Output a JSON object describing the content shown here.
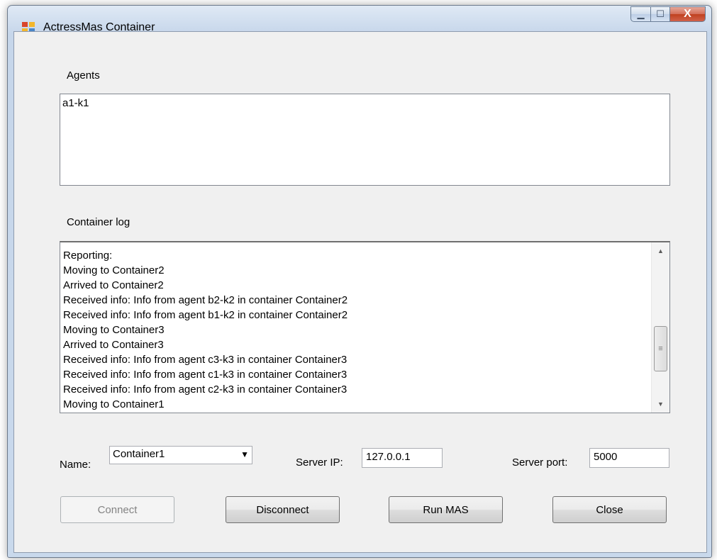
{
  "window": {
    "title": "ActressMas Container",
    "minimize_symbol": "▁",
    "maximize_symbol": "☐",
    "close_symbol": "X"
  },
  "agents": {
    "label": "Agents",
    "items": [
      "a1-k1"
    ]
  },
  "container_log": {
    "label": "Container log",
    "lines": [
      "Reporting:",
      "Moving to Container2",
      "Arrived to Container2",
      "Received info: Info from agent b2-k2 in container Container2",
      "Received info: Info from agent b1-k2 in container Container2",
      "Moving to Container3",
      "Arrived to Container3",
      "Received info: Info from agent c3-k3 in container Container3",
      "Received info: Info from agent c1-k3 in container Container3",
      "Received info: Info from agent c2-k3 in container Container3",
      "Moving to Container1"
    ]
  },
  "settings": {
    "name_label": "Name:",
    "name_value": "Container1",
    "server_ip_label": "Server IP:",
    "server_ip_value": "127.0.0.1",
    "server_port_label": "Server port:",
    "server_port_value": "5000"
  },
  "buttons": {
    "connect": "Connect",
    "disconnect": "Disconnect",
    "run_mas": "Run MAS",
    "close": "Close"
  },
  "icons": {
    "scroll_up": "▲",
    "scroll_down": "▼",
    "scroll_grip": "≡",
    "dropdown": "▼"
  }
}
